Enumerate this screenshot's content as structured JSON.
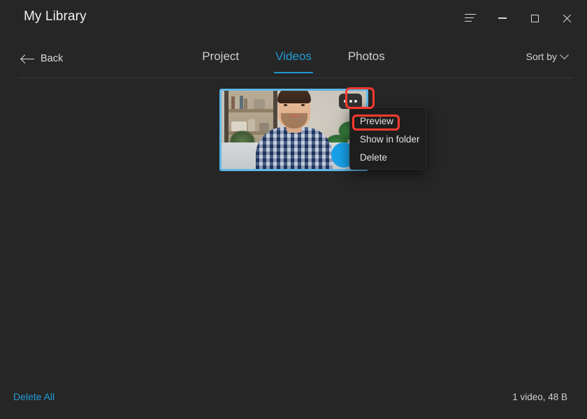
{
  "window": {
    "title": "My Library",
    "controls": [
      {
        "name": "menu-icon",
        "glyph": "hamburger",
        "tooltip": "Menu"
      },
      {
        "name": "minimize-icon",
        "glyph": "minimize",
        "tooltip": "Minimize"
      },
      {
        "name": "maximize-icon",
        "glyph": "maximize",
        "tooltip": "Maximize"
      },
      {
        "name": "close-icon",
        "glyph": "close",
        "tooltip": "Close"
      }
    ]
  },
  "nav": {
    "back_label": "Back",
    "back_icon": "arrow-left-icon",
    "tabs": [
      {
        "label": "Project",
        "active": false
      },
      {
        "label": "Videos",
        "active": true
      },
      {
        "label": "Photos",
        "active": false
      }
    ],
    "sort": {
      "label": "Sort by",
      "icon": "chevron-down-icon"
    }
  },
  "content": {
    "items": [
      {
        "type": "video",
        "selected": true,
        "more_icon": "ellipsis-icon",
        "badge_icon": "play-badge-icon",
        "thumbnail_alt": "Man in plaid shirt seated on a couch with bookshelf and plant"
      }
    ]
  },
  "context_menu": {
    "items": [
      {
        "label": "Preview",
        "highlighted": true
      },
      {
        "label": "Show in folder",
        "highlighted": false
      },
      {
        "label": "Delete",
        "highlighted": false
      }
    ]
  },
  "footer": {
    "delete_all_label": "Delete All",
    "stats": "1 video, 48 B"
  },
  "colors": {
    "background": "#262626",
    "accent": "#1f9bd4",
    "selection_border": "#5fb8e8",
    "menu_background": "#1e1e1e",
    "highlight_ring": "#ff3b30",
    "badge": "#18a0e8",
    "text_primary": "#e6e6e6"
  }
}
